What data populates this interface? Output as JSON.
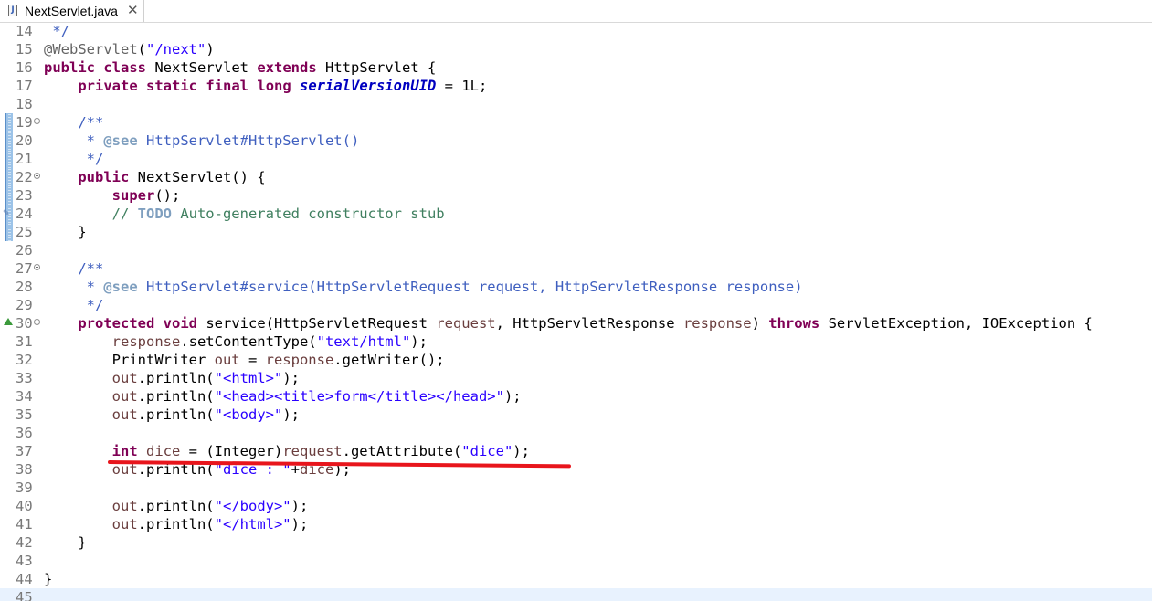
{
  "tab": {
    "title": "NextServlet.java",
    "close_symbol": "✕",
    "file_icon_letter": "J"
  },
  "lines": [
    {
      "num": "14",
      "segments": [
        {
          "t": " */",
          "c": "jdoc"
        }
      ]
    },
    {
      "num": "15",
      "segments": [
        {
          "t": "@WebServlet",
          "c": "ann"
        },
        {
          "t": "(",
          "c": ""
        },
        {
          "t": "\"/next\"",
          "c": "str"
        },
        {
          "t": ")",
          "c": ""
        }
      ]
    },
    {
      "num": "16",
      "segments": [
        {
          "t": "public",
          "c": "kw"
        },
        {
          "t": " ",
          "c": ""
        },
        {
          "t": "class",
          "c": "kw"
        },
        {
          "t": " NextServlet ",
          "c": ""
        },
        {
          "t": "extends",
          "c": "kw"
        },
        {
          "t": " HttpServlet {",
          "c": ""
        }
      ]
    },
    {
      "num": "17",
      "segments": [
        {
          "t": "    ",
          "c": ""
        },
        {
          "t": "private",
          "c": "kw"
        },
        {
          "t": " ",
          "c": ""
        },
        {
          "t": "static",
          "c": "kw"
        },
        {
          "t": " ",
          "c": ""
        },
        {
          "t": "final",
          "c": "kw"
        },
        {
          "t": " ",
          "c": ""
        },
        {
          "t": "long",
          "c": "kw"
        },
        {
          "t": " ",
          "c": ""
        },
        {
          "t": "serialVersionUID",
          "c": "field-static"
        },
        {
          "t": " = 1L;",
          "c": ""
        }
      ]
    },
    {
      "num": "18",
      "segments": []
    },
    {
      "num": "19",
      "fold": true,
      "marker": true,
      "segments": [
        {
          "t": "    /**",
          "c": "jdoc"
        }
      ]
    },
    {
      "num": "20",
      "marker": true,
      "segments": [
        {
          "t": "     * ",
          "c": "jdoc"
        },
        {
          "t": "@see",
          "c": "jtag"
        },
        {
          "t": " HttpServlet#HttpServlet()",
          "c": "jdoc"
        }
      ]
    },
    {
      "num": "21",
      "marker": true,
      "segments": [
        {
          "t": "     */",
          "c": "jdoc"
        }
      ]
    },
    {
      "num": "22",
      "fold": true,
      "marker": true,
      "segments": [
        {
          "t": "    ",
          "c": ""
        },
        {
          "t": "public",
          "c": "kw"
        },
        {
          "t": " NextServlet() {",
          "c": ""
        }
      ]
    },
    {
      "num": "23",
      "marker": true,
      "segments": [
        {
          "t": "        ",
          "c": ""
        },
        {
          "t": "super",
          "c": "kw"
        },
        {
          "t": "();",
          "c": ""
        }
      ]
    },
    {
      "num": "24",
      "marker": true,
      "task": true,
      "segments": [
        {
          "t": "        // ",
          "c": "cmt"
        },
        {
          "t": "TODO",
          "c": "todo"
        },
        {
          "t": " Auto-generated constructor stub",
          "c": "cmt"
        }
      ]
    },
    {
      "num": "25",
      "marker": true,
      "segments": [
        {
          "t": "    }",
          "c": ""
        }
      ]
    },
    {
      "num": "26",
      "segments": []
    },
    {
      "num": "27",
      "fold": true,
      "segments": [
        {
          "t": "    /**",
          "c": "jdoc"
        }
      ]
    },
    {
      "num": "28",
      "segments": [
        {
          "t": "     * ",
          "c": "jdoc"
        },
        {
          "t": "@see",
          "c": "jtag"
        },
        {
          "t": " HttpServlet#service(HttpServletRequest request, HttpServletResponse response)",
          "c": "jdoc"
        }
      ]
    },
    {
      "num": "29",
      "segments": [
        {
          "t": "     */",
          "c": "jdoc"
        }
      ]
    },
    {
      "num": "30",
      "fold": true,
      "override": true,
      "segments": [
        {
          "t": "    ",
          "c": ""
        },
        {
          "t": "protected",
          "c": "kw"
        },
        {
          "t": " ",
          "c": ""
        },
        {
          "t": "void",
          "c": "kw"
        },
        {
          "t": " service(HttpServletRequest ",
          "c": ""
        },
        {
          "t": "request",
          "c": "param"
        },
        {
          "t": ", HttpServletResponse ",
          "c": ""
        },
        {
          "t": "response",
          "c": "param"
        },
        {
          "t": ") ",
          "c": ""
        },
        {
          "t": "throws",
          "c": "kw"
        },
        {
          "t": " ServletException, IOException {",
          "c": ""
        }
      ]
    },
    {
      "num": "31",
      "segments": [
        {
          "t": "        ",
          "c": ""
        },
        {
          "t": "response",
          "c": "param"
        },
        {
          "t": ".setContentType(",
          "c": ""
        },
        {
          "t": "\"text/html\"",
          "c": "str"
        },
        {
          "t": ");",
          "c": ""
        }
      ]
    },
    {
      "num": "32",
      "segments": [
        {
          "t": "        PrintWriter ",
          "c": ""
        },
        {
          "t": "out",
          "c": "param"
        },
        {
          "t": " = ",
          "c": ""
        },
        {
          "t": "response",
          "c": "param"
        },
        {
          "t": ".getWriter();",
          "c": ""
        }
      ]
    },
    {
      "num": "33",
      "segments": [
        {
          "t": "        ",
          "c": ""
        },
        {
          "t": "out",
          "c": "param"
        },
        {
          "t": ".println(",
          "c": ""
        },
        {
          "t": "\"<html>\"",
          "c": "str"
        },
        {
          "t": ");",
          "c": ""
        }
      ]
    },
    {
      "num": "34",
      "segments": [
        {
          "t": "        ",
          "c": ""
        },
        {
          "t": "out",
          "c": "param"
        },
        {
          "t": ".println(",
          "c": ""
        },
        {
          "t": "\"<head><title>form</title></head>\"",
          "c": "str"
        },
        {
          "t": ");",
          "c": ""
        }
      ]
    },
    {
      "num": "35",
      "segments": [
        {
          "t": "        ",
          "c": ""
        },
        {
          "t": "out",
          "c": "param"
        },
        {
          "t": ".println(",
          "c": ""
        },
        {
          "t": "\"<body>\"",
          "c": "str"
        },
        {
          "t": ");",
          "c": ""
        }
      ]
    },
    {
      "num": "36",
      "segments": []
    },
    {
      "num": "37",
      "segments": [
        {
          "t": "        ",
          "c": ""
        },
        {
          "t": "int",
          "c": "kw"
        },
        {
          "t": " ",
          "c": ""
        },
        {
          "t": "dice",
          "c": "param"
        },
        {
          "t": " = (Integer)",
          "c": ""
        },
        {
          "t": "request",
          "c": "param"
        },
        {
          "t": ".getAttribute(",
          "c": ""
        },
        {
          "t": "\"dice\"",
          "c": "str"
        },
        {
          "t": ");",
          "c": ""
        }
      ]
    },
    {
      "num": "38",
      "segments": [
        {
          "t": "        ",
          "c": ""
        },
        {
          "t": "out",
          "c": "param"
        },
        {
          "t": ".println(",
          "c": ""
        },
        {
          "t": "\"dice : \"",
          "c": "str"
        },
        {
          "t": "+",
          "c": ""
        },
        {
          "t": "dice",
          "c": "param"
        },
        {
          "t": ");",
          "c": ""
        }
      ]
    },
    {
      "num": "39",
      "segments": []
    },
    {
      "num": "40",
      "segments": [
        {
          "t": "        ",
          "c": ""
        },
        {
          "t": "out",
          "c": "param"
        },
        {
          "t": ".println(",
          "c": ""
        },
        {
          "t": "\"</body>\"",
          "c": "str"
        },
        {
          "t": ");",
          "c": ""
        }
      ]
    },
    {
      "num": "41",
      "segments": [
        {
          "t": "        ",
          "c": ""
        },
        {
          "t": "out",
          "c": "param"
        },
        {
          "t": ".println(",
          "c": ""
        },
        {
          "t": "\"</html>\"",
          "c": "str"
        },
        {
          "t": ");",
          "c": ""
        }
      ]
    },
    {
      "num": "42",
      "segments": [
        {
          "t": "    }",
          "c": ""
        }
      ]
    },
    {
      "num": "43",
      "segments": []
    },
    {
      "num": "44",
      "segments": [
        {
          "t": "}",
          "c": ""
        }
      ]
    },
    {
      "num": "45",
      "current": true,
      "segments": []
    }
  ],
  "colors": {
    "keyword": "#7f0055",
    "string": "#2a00ff",
    "comment": "#3f7f5f",
    "javadoc": "#3f5fbf",
    "annotation": "#646464",
    "current_line": "#e8f2fe",
    "red_underline": "#e8151c"
  }
}
